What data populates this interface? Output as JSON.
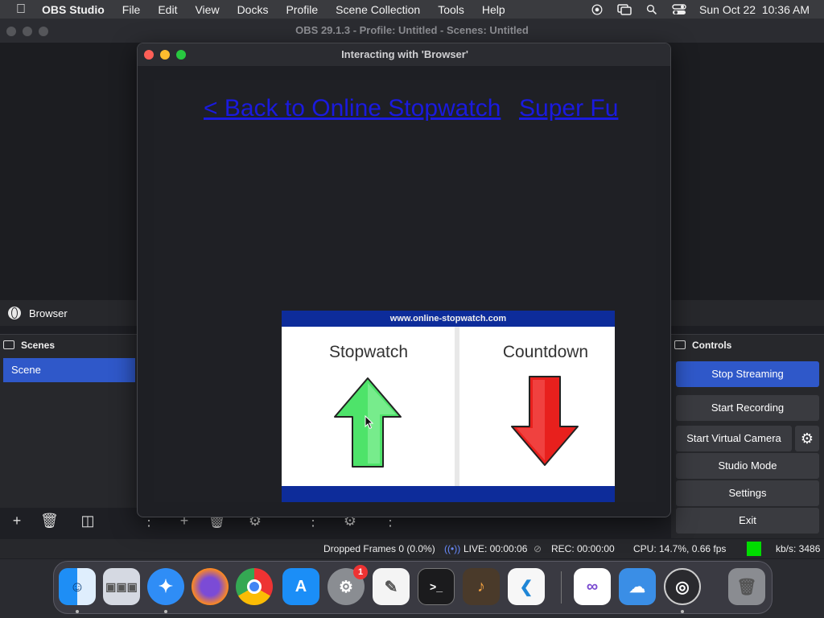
{
  "menubar": {
    "app_name": "OBS Studio",
    "items": [
      "File",
      "Edit",
      "View",
      "Docks",
      "Profile",
      "Scene Collection",
      "Tools",
      "Help"
    ],
    "datetime": "Sun Oct 22  10:36 AM"
  },
  "obs": {
    "title": "OBS 29.1.3 - Profile: Untitled - Scenes: Untitled",
    "source_name": "Browser",
    "scenes_header": "Scenes",
    "scene_item": "Scene",
    "controls_header": "Controls",
    "controls": {
      "stop_streaming": "Stop Streaming",
      "start_recording": "Start Recording",
      "start_virtual_camera": "Start Virtual Camera",
      "studio_mode": "Studio Mode",
      "settings": "Settings",
      "exit": "Exit"
    }
  },
  "status": {
    "dropped_frames": "Dropped Frames 0 (0.0%)",
    "live": "LIVE: 00:00:06",
    "rec": "REC: 00:00:00",
    "cpu": "CPU: 14.7%, 0.66 fps",
    "kbs": "kb/s: 3486"
  },
  "interact_window": {
    "title": "Interacting with 'Browser'",
    "back_link": "< Back to Online Stopwatch",
    "super_link": "Super Fu",
    "widget_banner": "www.online-stopwatch.com",
    "stopwatch_label": "Stopwatch",
    "countdown_label": "Countdown"
  },
  "dock": {
    "apps": [
      "finder-icon",
      "launchpad-icon",
      "safari-icon",
      "firefox-icon",
      "chrome-icon",
      "app-store-icon",
      "system-settings-icon",
      "textedit-icon",
      "terminal-icon",
      "garageband-icon",
      "vscode-icon",
      "visual-studio-icon",
      "weather-icon",
      "obs-icon",
      "trash-icon"
    ],
    "settings_badge": "1"
  },
  "colors": {
    "accent_blue": "#2f58c9",
    "live_indicator": "#00dc00",
    "arrow_up": "#4ee36a",
    "arrow_down": "#e8201d"
  }
}
